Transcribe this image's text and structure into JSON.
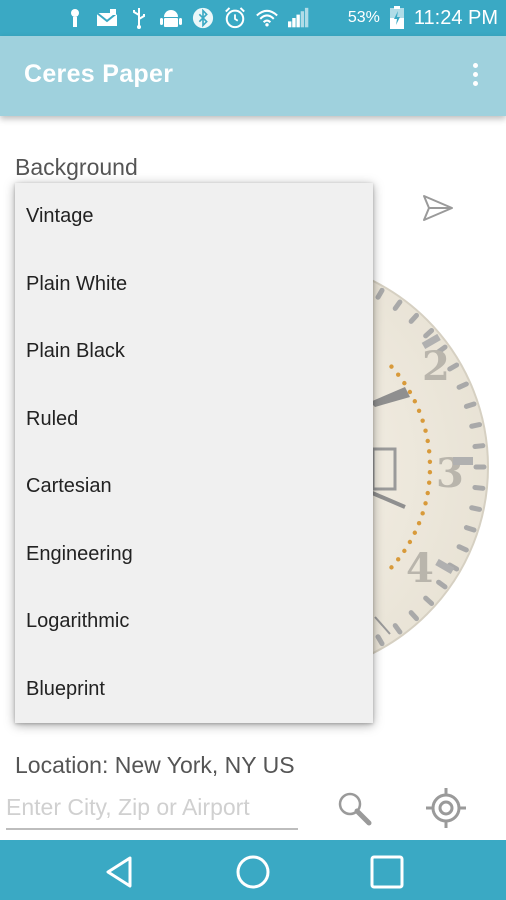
{
  "status_bar": {
    "battery_percent": "53%",
    "time": "11:24 PM"
  },
  "app_bar": {
    "title": "Ceres Paper"
  },
  "settings": {
    "background_label": "Background",
    "location_label": "Location: New York, NY US",
    "city_placeholder": "Enter City, Zip or Airport",
    "city_value": ""
  },
  "dropdown": {
    "options": [
      "Vintage",
      "Plain White",
      "Plain Black",
      "Ruled",
      "Cartesian",
      "Engineering",
      "Logarithmic",
      "Blueprint"
    ]
  },
  "dial": {
    "numerals": [
      "2",
      "3",
      "4"
    ]
  },
  "colors": {
    "status_bar": "#3aa9c4",
    "app_bar": "#9fd1dd",
    "nav_bar": "#3aa9c4",
    "dropdown_bg": "#f0f0f0",
    "dial_accent": "#d89a3a"
  },
  "icons": {
    "status": [
      "alarm-off-icon",
      "mail-icon",
      "usb-icon",
      "android-icon",
      "bluetooth-icon",
      "alarm-icon",
      "wifi-icon",
      "signal-icon",
      "battery-icon"
    ],
    "send": "send-icon",
    "search": "search-icon",
    "locate": "gps-locate-icon",
    "nav": [
      "back-icon",
      "home-icon",
      "recents-icon"
    ]
  }
}
